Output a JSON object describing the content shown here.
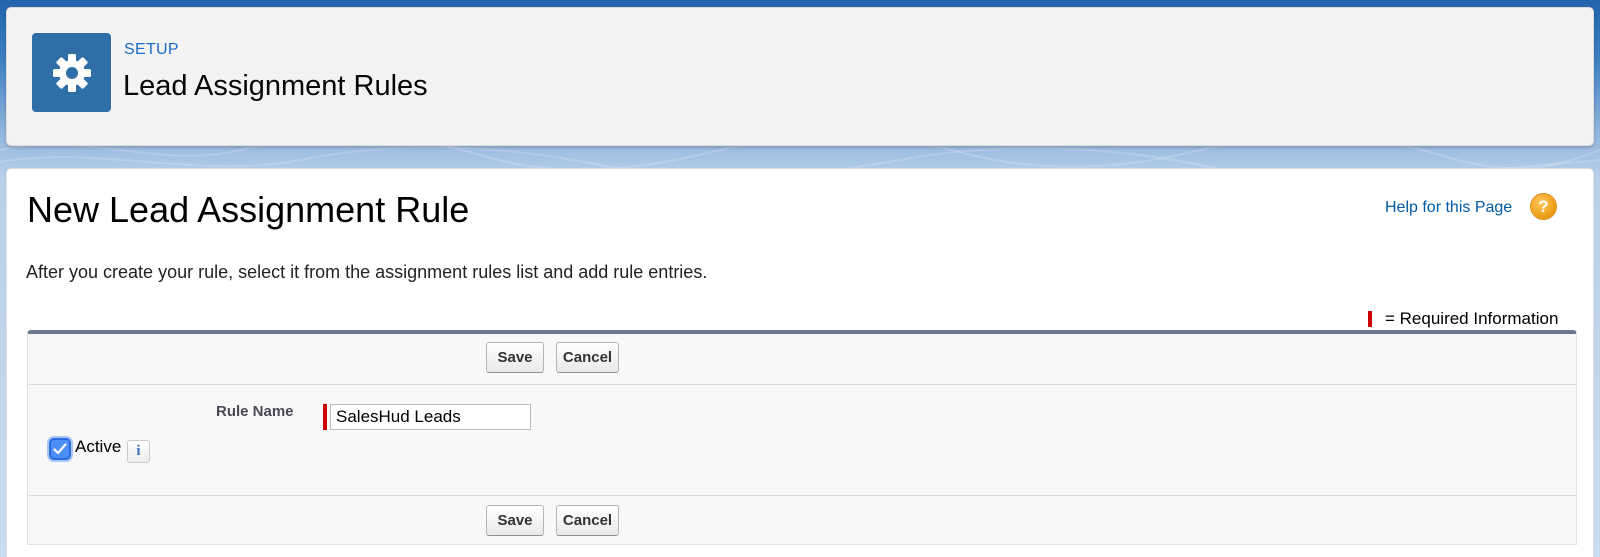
{
  "header": {
    "section_label": "SETUP",
    "title": "Lead Assignment Rules",
    "icon": "gear-icon"
  },
  "page": {
    "title": "New Lead Assignment Rule",
    "help_link": "Help for this Page",
    "help_icon_glyph": "?",
    "intro": "After you create your rule, select it from the assignment rules list and add rule entries.",
    "required_legend": "= Required Information"
  },
  "form": {
    "save_label": "Save",
    "cancel_label": "Cancel",
    "rule_name_label": "Rule Name",
    "rule_name_value": "SalesHud Leads",
    "active_label": "Active",
    "active_checked": true,
    "info_glyph": "i"
  },
  "colors": {
    "accent": "#2e6fa8",
    "link": "#015ba7",
    "required": "#cc0000",
    "help_icon": "#ea9a13"
  }
}
